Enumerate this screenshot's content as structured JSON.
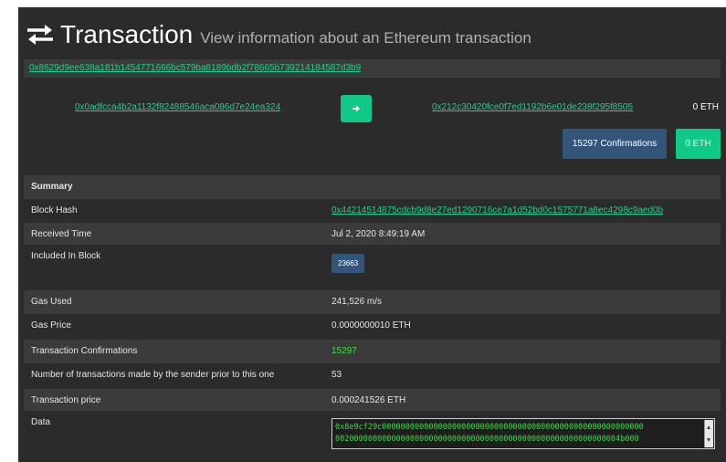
{
  "header": {
    "icon": "exchange-arrows-icon",
    "title": "Transaction",
    "subtitle": "View information about an Ethereum transaction"
  },
  "tx_hash": "0x8629d9ee638a181b1454771666bc579ba8189bdb2f78665b739214184587d3b9",
  "transfer": {
    "from": "0x0adfcca4b2a1132f82488546aca086d7e24ea324",
    "arrow_icon": "arrow-right-icon",
    "to": "0x212c30420fce0f7ed1192b6e01de238f295f8505",
    "to_amount": "0 ETH",
    "confirmations_button": "15297 Confirmations",
    "amount_button": "0 ETH"
  },
  "summary": {
    "heading": "Summary",
    "block_hash_label": "Block Hash",
    "block_hash": "0x44214514875cdcb9d8e27ed1290716ce7a1d52bd0c1575771a8ec4298c9aed0b",
    "received_time_label": "Received Time",
    "received_time": "Jul 2, 2020 8:49:19 AM",
    "included_block_label": "Included In Block",
    "included_block": "23663",
    "gas_used_label": "Gas Used",
    "gas_used": "241,526 m/s",
    "gas_price_label": "Gas Price",
    "gas_price": "0.0000000010 ETH",
    "confirmations_label": "Transaction Confirmations",
    "confirmations": "15297",
    "nonce_label": "Number of transactions made by the sender prior to this one",
    "nonce": "53",
    "price_label": "Transaction price",
    "price": "0.000241526 ETH",
    "data_label": "Data",
    "data_line1": "0x8e9cf29c00000000000000000000000000000000000000000000000000000000",
    "data_line2": "0020000000000000000000000000000000000000000000000000000000004b000"
  },
  "colors": {
    "background": "#2b2b2b",
    "row_alt": "#3b3b3b",
    "accent_green": "#10c986",
    "link_green": "#1fd18a",
    "badge_blue": "#34557a",
    "confirm_green": "#36e03a"
  }
}
